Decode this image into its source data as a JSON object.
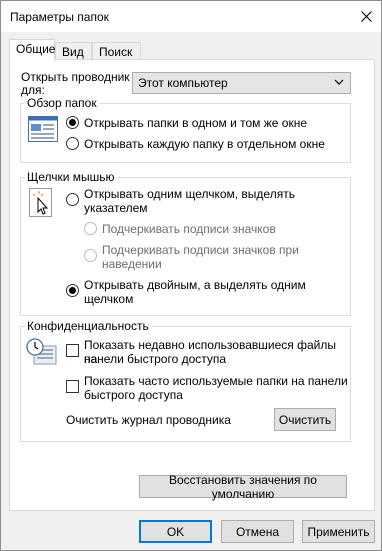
{
  "window": {
    "title": "Параметры папок"
  },
  "tabs": [
    {
      "label": "Общие",
      "active": true
    },
    {
      "label": "Вид",
      "active": false
    },
    {
      "label": "Поиск",
      "active": false
    }
  ],
  "open_explorer": {
    "label": "Открыть проводник для:",
    "label_line1": "Открыть проводник",
    "label_line2": "для:",
    "selected": "Этот компьютер"
  },
  "browse": {
    "title": "Обзор папок",
    "options": [
      {
        "label": "Открывать папки в одном и том же окне",
        "checked": true
      },
      {
        "label": "Открывать каждую папку в отдельном окне",
        "checked": false
      }
    ]
  },
  "clicks": {
    "title": "Щелчки мышью",
    "single": {
      "line1": "Открывать одним щелчком, выделять",
      "line2": "указателем",
      "checked": false
    },
    "underline_always": {
      "label": "Подчеркивать подписи значков",
      "enabled": false
    },
    "underline_hover": {
      "line1": "Подчеркивать подписи значков при",
      "line2": "наведении",
      "enabled": false
    },
    "double": {
      "line1": "Открывать двойным, а выделять одним",
      "line2": "щелчком",
      "checked": true
    }
  },
  "privacy": {
    "title": "Конфиденциальность",
    "recent_files": {
      "line1": "Показать недавно использовавшиеся файлы на",
      "line2": "панели быстрого доступа",
      "checked": false
    },
    "frequent_folders": {
      "line1": "Показать часто используемые папки на панели",
      "line2": "быстрого доступа",
      "checked": false
    },
    "clear_history_label": "Очистить журнал проводника",
    "clear_button": "Очистить"
  },
  "restore_defaults": "Восстановить значения по умолчанию",
  "footer": {
    "ok": "OK",
    "cancel": "Отмена",
    "apply": "Применить"
  },
  "colors": {
    "accent": "#0078d7",
    "window_bg": "#f0f0f0",
    "panel_bg": "#ffffff"
  }
}
